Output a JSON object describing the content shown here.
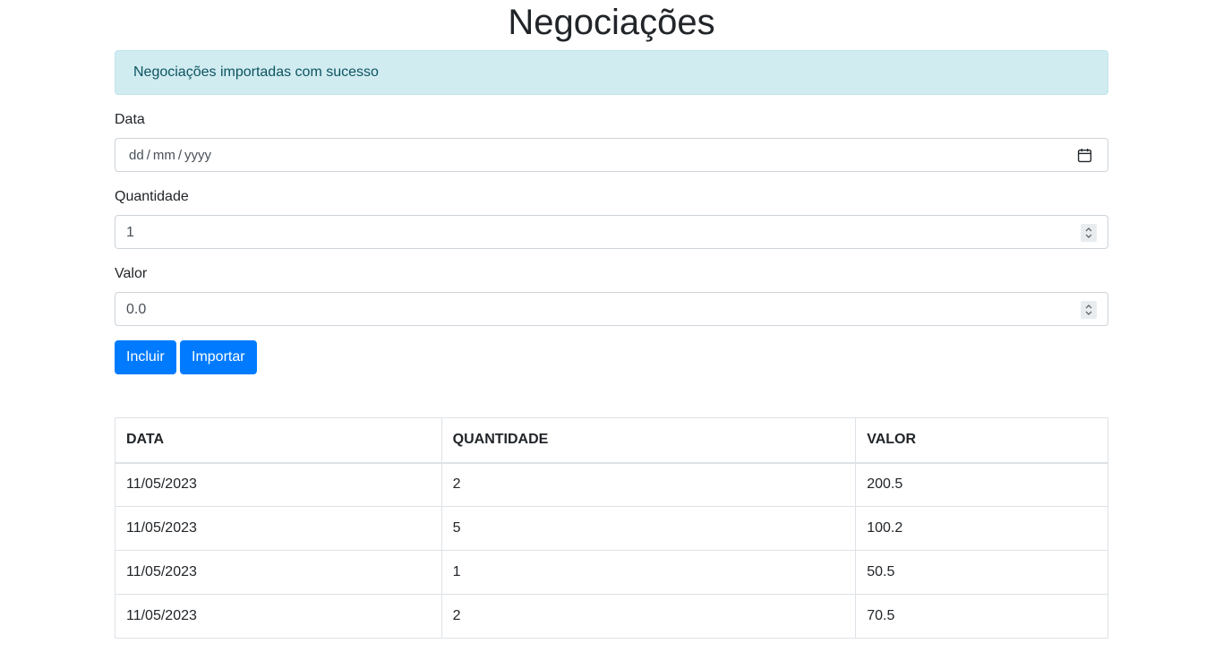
{
  "page": {
    "title": "Negociações"
  },
  "alert": {
    "message": "Negociações importadas com sucesso"
  },
  "form": {
    "data": {
      "label": "Data",
      "day_placeholder": "dd",
      "month_placeholder": "mm",
      "year_placeholder": "yyyy",
      "separator": "/",
      "icon": "calendar-icon"
    },
    "quantidade": {
      "label": "Quantidade",
      "value": "1",
      "icon": "spinner-icon"
    },
    "valor": {
      "label": "Valor",
      "value": "0.0",
      "icon": "spinner-icon"
    }
  },
  "buttons": {
    "incluir": "Incluir",
    "importar": "Importar",
    "color": "#007bff"
  },
  "table": {
    "headers": [
      "DATA",
      "QUANTIDADE",
      "VALOR"
    ],
    "rows": [
      [
        "11/05/2023",
        "2",
        "200.5"
      ],
      [
        "11/05/2023",
        "5",
        "100.2"
      ],
      [
        "11/05/2023",
        "1",
        "50.5"
      ],
      [
        "11/05/2023",
        "2",
        "70.5"
      ]
    ]
  }
}
